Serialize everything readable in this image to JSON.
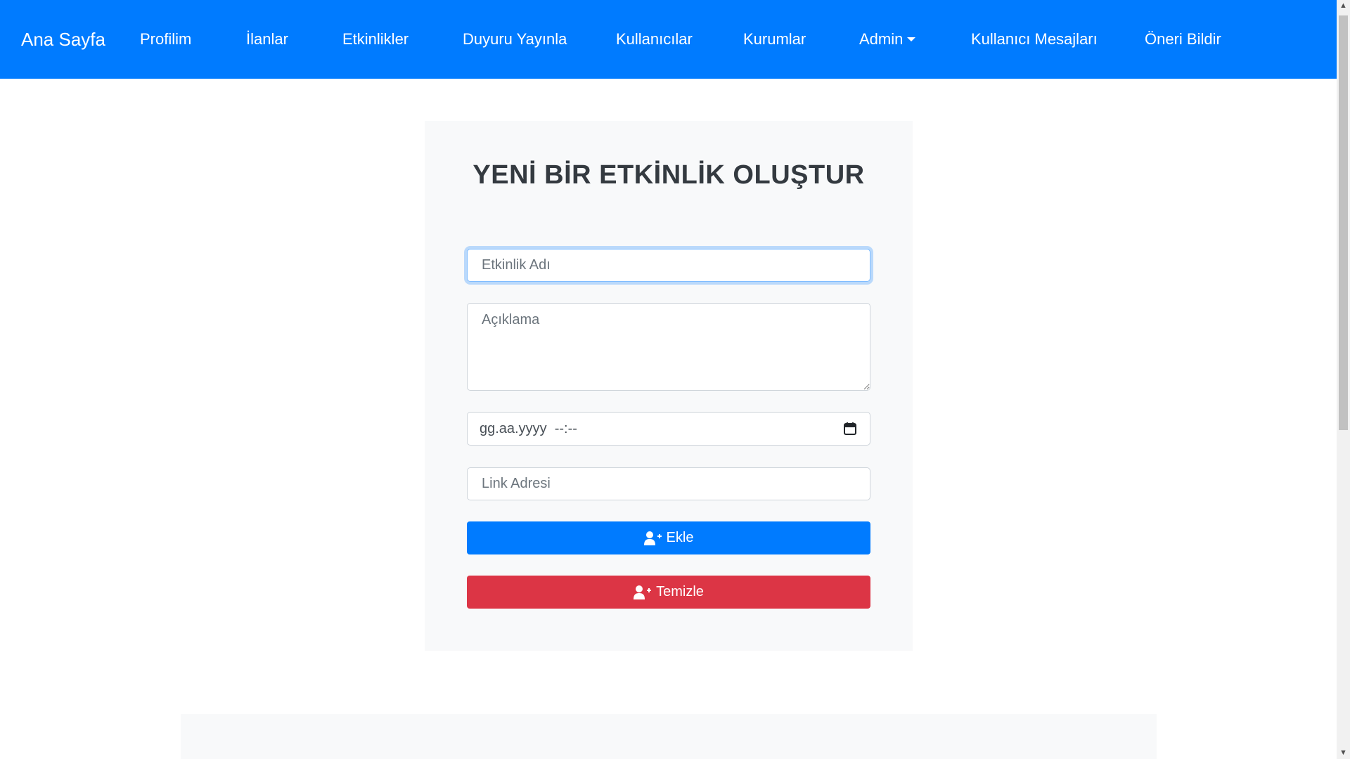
{
  "navbar": {
    "brand": "Ana Sayfa",
    "items": [
      {
        "label": "Profilim"
      },
      {
        "label": "İlanlar"
      },
      {
        "label": "Etkinlikler"
      },
      {
        "label": "Duyuru Yayınla"
      },
      {
        "label": "Kullanıcılar"
      },
      {
        "label": "Kurumlar"
      },
      {
        "label": "Admin"
      },
      {
        "label": "Kullanıcı Mesajları"
      },
      {
        "label": "Öneri Bildir"
      }
    ]
  },
  "form": {
    "title": "YENİ BİR ETKİNLİK OLUŞTUR",
    "name_placeholder": "Etkinlik Adı",
    "name_value": "",
    "description_placeholder": "Açıklama",
    "description_value": "",
    "datetime_value": "gg.aa.yyyy  --:--",
    "link_placeholder": "Link Adresi",
    "link_value": "",
    "add_button_label": "Ekle",
    "clear_button_label": "Temizle"
  },
  "icons": {
    "admin_dropdown": "caret-down-icon",
    "date_picker": "calendar-icon",
    "add_button": "user-plus-icon",
    "clear_button": "user-plus-icon"
  },
  "colors": {
    "navbar": "#007bff",
    "primary": "#007bff",
    "danger": "#dc3545",
    "card_bg": "#f8f9fa"
  }
}
